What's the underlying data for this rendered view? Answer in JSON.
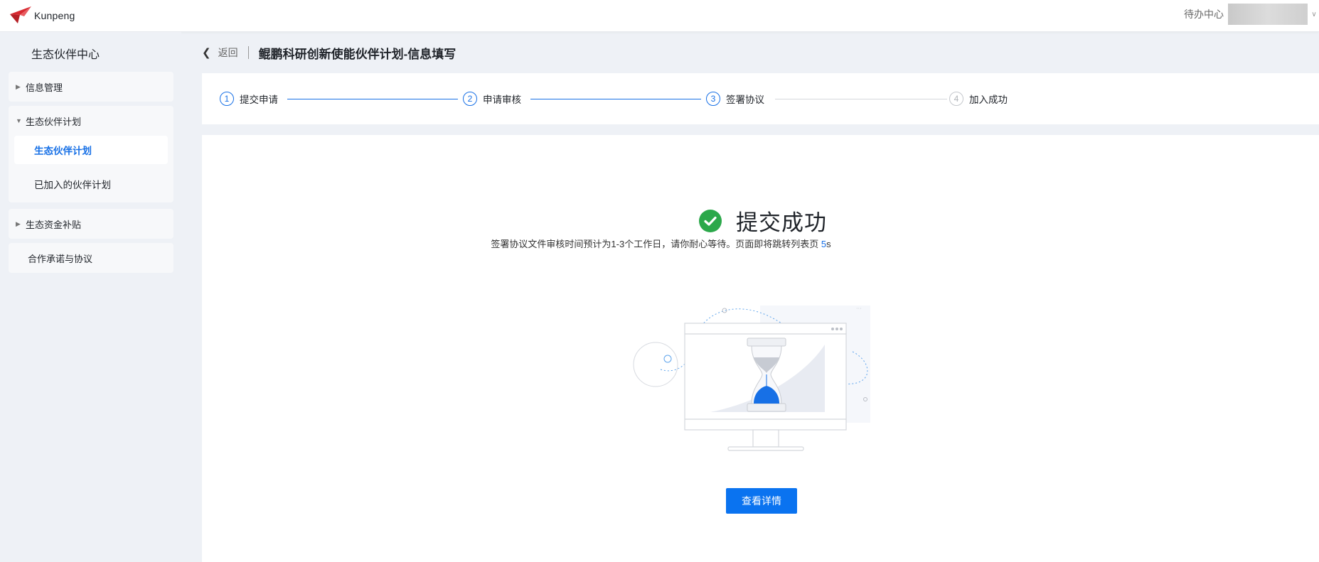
{
  "header": {
    "logo_text": "Kunpeng",
    "todo_label": "待办中心",
    "logo_icon": "kunpeng-logo-icon",
    "dropdown_icon": "chevron-down-icon"
  },
  "sidebar": {
    "title": "生态伙伴中心",
    "groups": [
      {
        "label": "信息管理",
        "expanded": false
      },
      {
        "label": "生态伙伴计划",
        "expanded": true,
        "items": [
          {
            "label": "生态伙伴计划",
            "active": true
          },
          {
            "label": "已加入的伙伴计划",
            "active": false
          }
        ]
      },
      {
        "label": "生态资金补贴",
        "expanded": false
      },
      {
        "label": "合作承诺与协议",
        "expanded": false
      }
    ]
  },
  "main": {
    "back_label": "返回",
    "page_title": "鲲鹏科研创新使能伙伴计划-信息填写",
    "steps": [
      {
        "num": "1",
        "label": "提交申请",
        "status": "done"
      },
      {
        "num": "2",
        "label": "申请审核",
        "status": "done"
      },
      {
        "num": "3",
        "label": "签署协议",
        "status": "current"
      },
      {
        "num": "4",
        "label": "加入成功",
        "status": "pending"
      }
    ],
    "result": {
      "title": "提交成功",
      "notice": "签署协议文件审核时间预计为1-3个工作日，请你耐心等待。页面即将跳转列表页 ",
      "countdown": "5",
      "countdown_unit": "s",
      "icon": "check-circle-icon",
      "illustration": "hourglass-monitor-illustration"
    },
    "detail_button": "查看详情"
  },
  "colors": {
    "primary": "#1770e6",
    "button": "#0a73f0",
    "success": "#2ba84a",
    "bg": "#eef1f6"
  }
}
